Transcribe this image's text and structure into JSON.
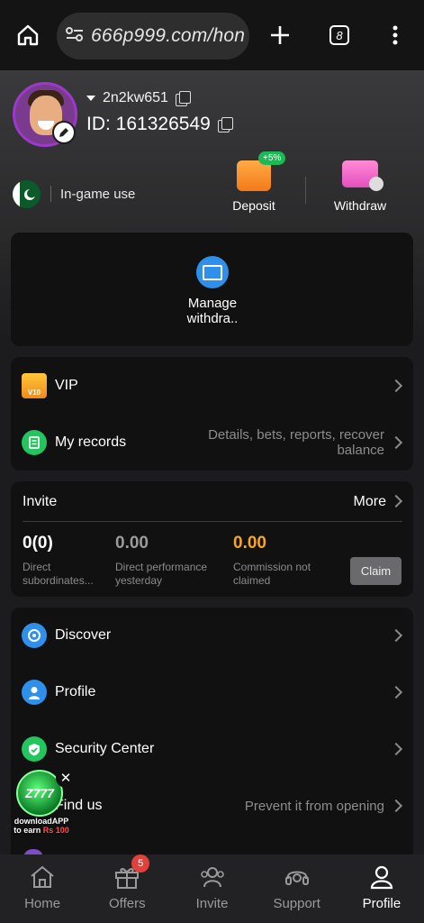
{
  "browser": {
    "url": "666p999.com/hon",
    "tab_count": "8"
  },
  "profile": {
    "username": "2n2kw651",
    "id_text": "ID: 161326549",
    "region_label": "In-game use"
  },
  "actions": {
    "deposit_label": "Deposit",
    "deposit_badge": "+5%",
    "withdraw_label": "Withdraw"
  },
  "manage": {
    "label": "Manage withdra.."
  },
  "menu": {
    "vip_label": "VIP",
    "vip_level": "V10",
    "records_label": "My records",
    "records_hint": "Details, bets, reports, recover balance"
  },
  "invite": {
    "title": "Invite",
    "more": "More",
    "stats": [
      {
        "value": "0(0)",
        "label": "Direct subordinates..."
      },
      {
        "value": "0.00",
        "label": "Direct performance yesterday"
      },
      {
        "value": "0.00",
        "label": "Commission not claimed"
      }
    ],
    "claim_label": "Claim"
  },
  "list": {
    "discover": "Discover",
    "profile": "Profile",
    "security": "Security Center",
    "find_us": "Find us",
    "find_us_hint": "Prevent it from opening"
  },
  "promo": {
    "logo_text": "Z777",
    "line1": "downloadAPP",
    "line2": "to earn",
    "amount": "Rs 100"
  },
  "tabbar": {
    "home": "Home",
    "offers": "Offers",
    "offers_badge": "5",
    "invite": "Invite",
    "support": "Support",
    "profile": "Profile"
  },
  "colors": {
    "accent_orange": "#f5a623",
    "accent_green": "#1db954",
    "accent_blue": "#2e90ea",
    "badge_red": "#e0413a"
  }
}
